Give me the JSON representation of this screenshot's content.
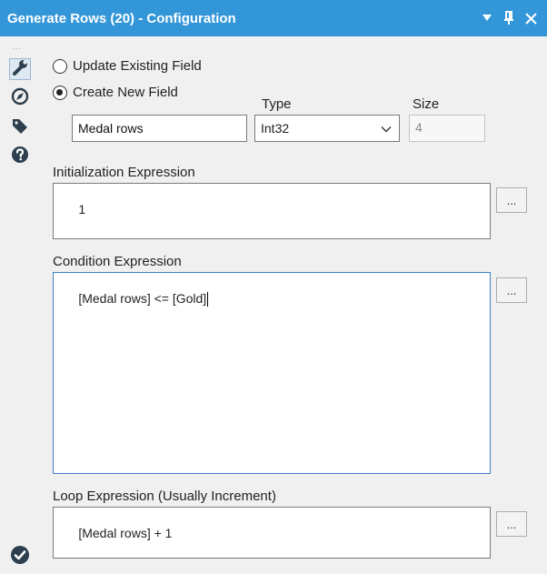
{
  "window": {
    "title": "Generate Rows (20) - Configuration"
  },
  "sidebar": {
    "grip": "...",
    "items": [
      {
        "icon": "wrench-icon"
      },
      {
        "icon": "compass-icon"
      },
      {
        "icon": "tag-icon"
      },
      {
        "icon": "help-icon"
      }
    ],
    "status_icon": "check-circle-icon"
  },
  "field_options": {
    "update_label": "Update Existing Field",
    "create_label": "Create New  Field",
    "selected": "create"
  },
  "new_field": {
    "name_value": "Medal rows",
    "type_label": "Type",
    "type_value": "Int32",
    "size_label": "Size",
    "size_value": "4"
  },
  "expressions": {
    "init_label": "Initialization Expression",
    "init_value": "1",
    "condition_label": "Condition Expression",
    "condition_value": "[Medal rows] <= [Gold]",
    "loop_label": "Loop Expression (Usually Increment)",
    "loop_value": "[Medal rows] + 1",
    "button_label": "..."
  },
  "colors": {
    "titlebar": "#3396d8",
    "icon": "#2d3e4e"
  }
}
